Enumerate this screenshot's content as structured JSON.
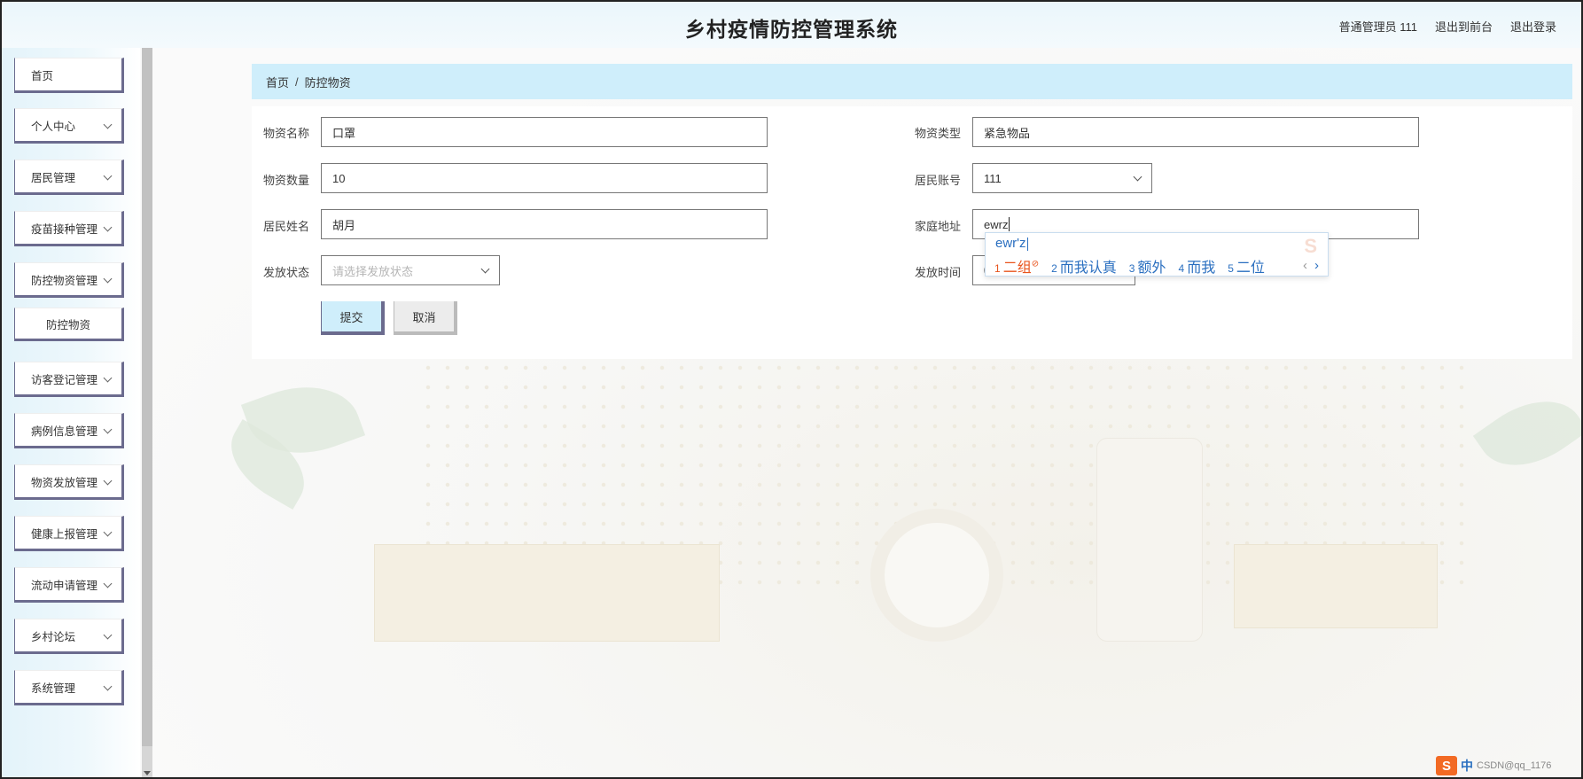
{
  "header": {
    "title": "乡村疫情防控管理系统",
    "user_label": "普通管理员 111",
    "to_frontend": "退出到前台",
    "logout": "退出登录"
  },
  "sidebar": {
    "items": [
      {
        "label": "首页",
        "expandable": false
      },
      {
        "label": "个人中心",
        "expandable": true
      },
      {
        "label": "居民管理",
        "expandable": true
      },
      {
        "label": "疫苗接种管理",
        "expandable": true
      },
      {
        "label": "防控物资管理",
        "expandable": true
      },
      {
        "label": "防控物资",
        "expandable": false,
        "sub": true
      },
      {
        "label": "访客登记管理",
        "expandable": true
      },
      {
        "label": "病例信息管理",
        "expandable": true
      },
      {
        "label": "物资发放管理",
        "expandable": true
      },
      {
        "label": "健康上报管理",
        "expandable": true
      },
      {
        "label": "流动申请管理",
        "expandable": true
      },
      {
        "label": "乡村论坛",
        "expandable": true
      },
      {
        "label": "系统管理",
        "expandable": true
      }
    ]
  },
  "breadcrumb": {
    "home": "首页",
    "separator": "/",
    "current": "防控物资"
  },
  "form": {
    "name": {
      "label": "物资名称",
      "value": "口罩"
    },
    "type": {
      "label": "物资类型",
      "value": "紧急物品"
    },
    "quantity": {
      "label": "物资数量",
      "value": "10"
    },
    "account": {
      "label": "居民账号",
      "value": "111"
    },
    "resident_name": {
      "label": "居民姓名",
      "value": "胡月"
    },
    "address": {
      "label": "家庭地址",
      "value": "ewrz"
    },
    "status": {
      "label": "发放状态",
      "placeholder": "请选择发放状态"
    },
    "time": {
      "label": "发放时间"
    },
    "submit": "提交",
    "cancel": "取消"
  },
  "ime": {
    "composition": "ewr'z",
    "candidates": [
      {
        "num": "1",
        "text": "二组"
      },
      {
        "num": "2",
        "text": "而我认真"
      },
      {
        "num": "3",
        "text": "额外"
      },
      {
        "num": "4",
        "text": "而我"
      },
      {
        "num": "5",
        "text": "二位"
      }
    ],
    "prev": "‹",
    "next": "›",
    "bar_logo": "S",
    "bar_mode": "中",
    "bar_watermark": "CSDN@qq_1176"
  },
  "colors": {
    "accent": "#cfeefb",
    "menu_border": "#6b6b8e",
    "ime_blue": "#2a6fc0",
    "ime_orange": "#e8541d"
  }
}
